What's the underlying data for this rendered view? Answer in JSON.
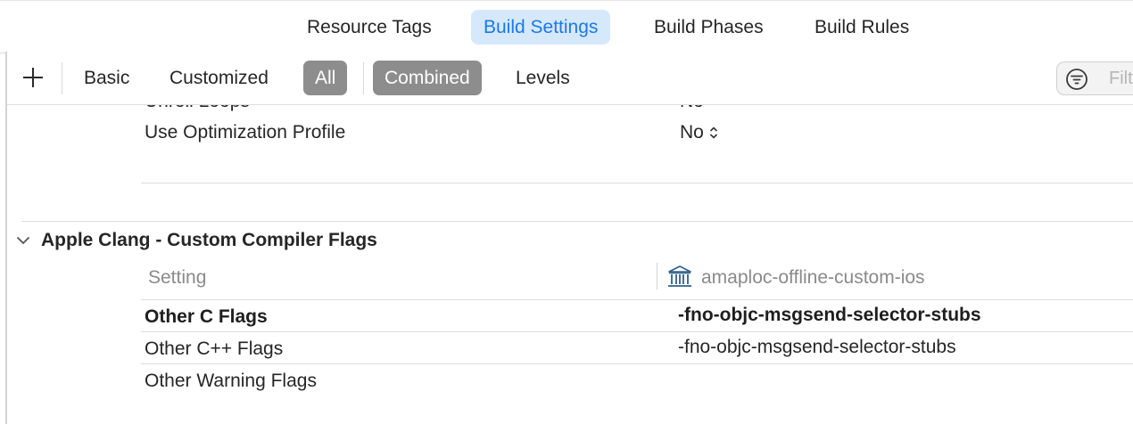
{
  "tabs": [
    {
      "label": "Resource Tags",
      "active": false
    },
    {
      "label": "Build Settings",
      "active": true
    },
    {
      "label": "Build Phases",
      "active": false
    },
    {
      "label": "Build Rules",
      "active": false
    }
  ],
  "toolbar": {
    "add_icon": "plus-icon",
    "filters": [
      {
        "label": "Basic",
        "selected": false
      },
      {
        "label": "Customized",
        "selected": false
      },
      {
        "label": "All",
        "selected": true
      }
    ],
    "views": [
      {
        "label": "Combined",
        "selected": true
      },
      {
        "label": "Levels",
        "selected": false
      }
    ],
    "search": {
      "placeholder": "Filter",
      "visible_placeholder": "Filt",
      "icon": "filter-icon"
    }
  },
  "settings_above": [
    {
      "name": "Unroll Loops",
      "visible_name": "Unroll Loops",
      "value": "No"
    },
    {
      "name": "Use Optimization Profile",
      "value": "No"
    }
  ],
  "section": {
    "title": "Apple Clang - Custom Compiler Flags",
    "expanded": true,
    "column_setting": "Setting",
    "column_target": "amaploc-offline-custom-ios",
    "target_icon": "project-building-icon",
    "rows": [
      {
        "name": "Other C Flags",
        "value": "-fno-objc-msgsend-selector-stubs",
        "bold": true
      },
      {
        "name": "Other C++ Flags",
        "value": "-fno-objc-msgsend-selector-stubs",
        "bold": false
      },
      {
        "name": "Other Warning Flags",
        "value": "",
        "bold": false
      }
    ]
  },
  "colors": {
    "accent": "#1b79e8",
    "accent_bg": "#d6e8fb",
    "segment_selected": "#8d8d8d"
  }
}
